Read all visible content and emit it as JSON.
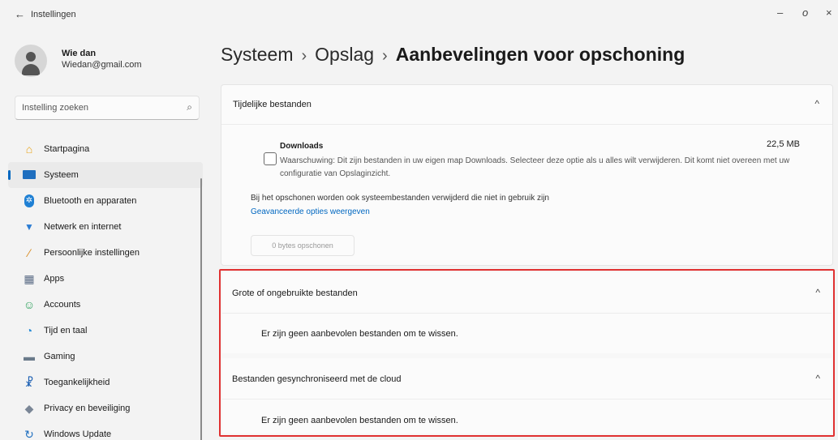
{
  "window": {
    "back_glyph": "←",
    "title": "Instellingen",
    "minimize": "–",
    "maximize": "o",
    "close": "×"
  },
  "profile": {
    "name": "Wie dan",
    "email": "Wiedan@gmail.com"
  },
  "search": {
    "placeholder": "Instelling zoeken",
    "icon": "search-icon"
  },
  "sidebar": {
    "items": [
      {
        "label": "Startpagina",
        "icon": "home-icon",
        "active": false
      },
      {
        "label": "Systeem",
        "icon": "system-icon",
        "active": true
      },
      {
        "label": "Bluetooth en apparaten",
        "icon": "bluetooth-icon",
        "active": false
      },
      {
        "label": "Netwerk en internet",
        "icon": "network-icon",
        "active": false
      },
      {
        "label": "Persoonlijke instellingen",
        "icon": "brush-icon",
        "active": false
      },
      {
        "label": "Apps",
        "icon": "apps-icon",
        "active": false
      },
      {
        "label": "Accounts",
        "icon": "accounts-icon",
        "active": false
      },
      {
        "label": "Tijd en taal",
        "icon": "time-language-icon",
        "active": false
      },
      {
        "label": "Gaming",
        "icon": "gaming-icon",
        "active": false
      },
      {
        "label": "Toegankelijkheid",
        "icon": "accessibility-icon",
        "active": false
      },
      {
        "label": "Privacy en beveiliging",
        "icon": "shield-icon",
        "active": false
      },
      {
        "label": "Windows Update",
        "icon": "update-icon",
        "active": false
      }
    ]
  },
  "breadcrumb": {
    "level1": "Systeem",
    "level2": "Opslag",
    "current": "Aanbevelingen voor opschoning",
    "separator": "›"
  },
  "temp_files": {
    "title": "Tijdelijke bestanden",
    "chevron": "^",
    "downloads": {
      "name": "Downloads",
      "size": "22,5 MB",
      "checked": false,
      "description": "Waarschuwing: Dit zijn bestanden in uw eigen map Downloads. Selecteer deze optie als u alles wilt verwijderen. Dit komt niet overeen met uw configuratie van Opslaginzicht."
    },
    "system_note": "Bij het opschonen worden ook systeembestanden verwijderd die niet in gebruik zijn",
    "advanced_link": "Geavanceerde opties weergeven",
    "clean_button": "0 bytes opschonen"
  },
  "large_files": {
    "title": "Grote of ongebruikte bestanden",
    "chevron": "^",
    "empty_message": "Er zijn geen aanbevolen bestanden om te wissen."
  },
  "cloud_files": {
    "title": "Bestanden gesynchroniseerd met de cloud",
    "chevron": "^",
    "empty_message": "Er zijn geen aanbevolen bestanden om te wissen."
  },
  "colors": {
    "accent": "#0067c0",
    "highlight_border": "#e03131",
    "background": "#f3f3f3",
    "card": "#fbfbfb"
  }
}
